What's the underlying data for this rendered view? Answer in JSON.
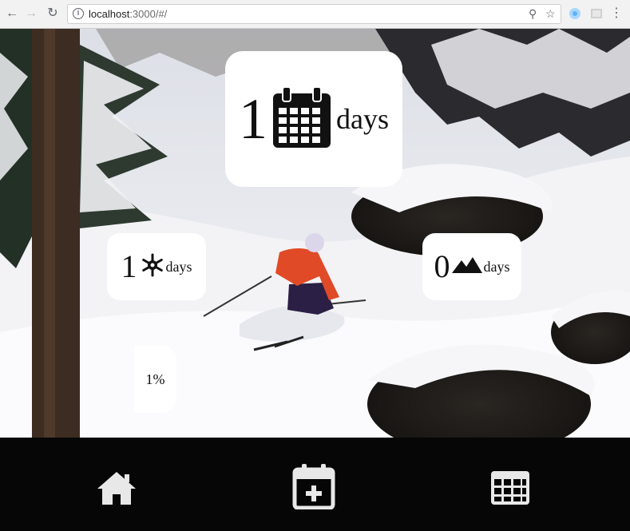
{
  "browser": {
    "url_host": "localhost",
    "url_path": ":3000/#/"
  },
  "cards": {
    "days_total": {
      "value": "1",
      "unit": "days",
      "icon": "calendar-icon"
    },
    "days_snow": {
      "value": "1",
      "unit": "days",
      "icon": "snowflake-icon"
    },
    "days_mountain": {
      "value": "0",
      "unit": "days",
      "icon": "mountain-icon"
    },
    "percent": {
      "label": "1%"
    }
  },
  "bottom_nav": {
    "items": [
      {
        "name": "home",
        "icon": "home-icon"
      },
      {
        "name": "add-day",
        "icon": "calendar-plus-icon"
      },
      {
        "name": "calendar",
        "icon": "calendar-grid-icon"
      }
    ]
  },
  "colors": {
    "nav_background": "#060606",
    "card_background": "#ffffff",
    "icon_color": "#e8e8e8"
  }
}
